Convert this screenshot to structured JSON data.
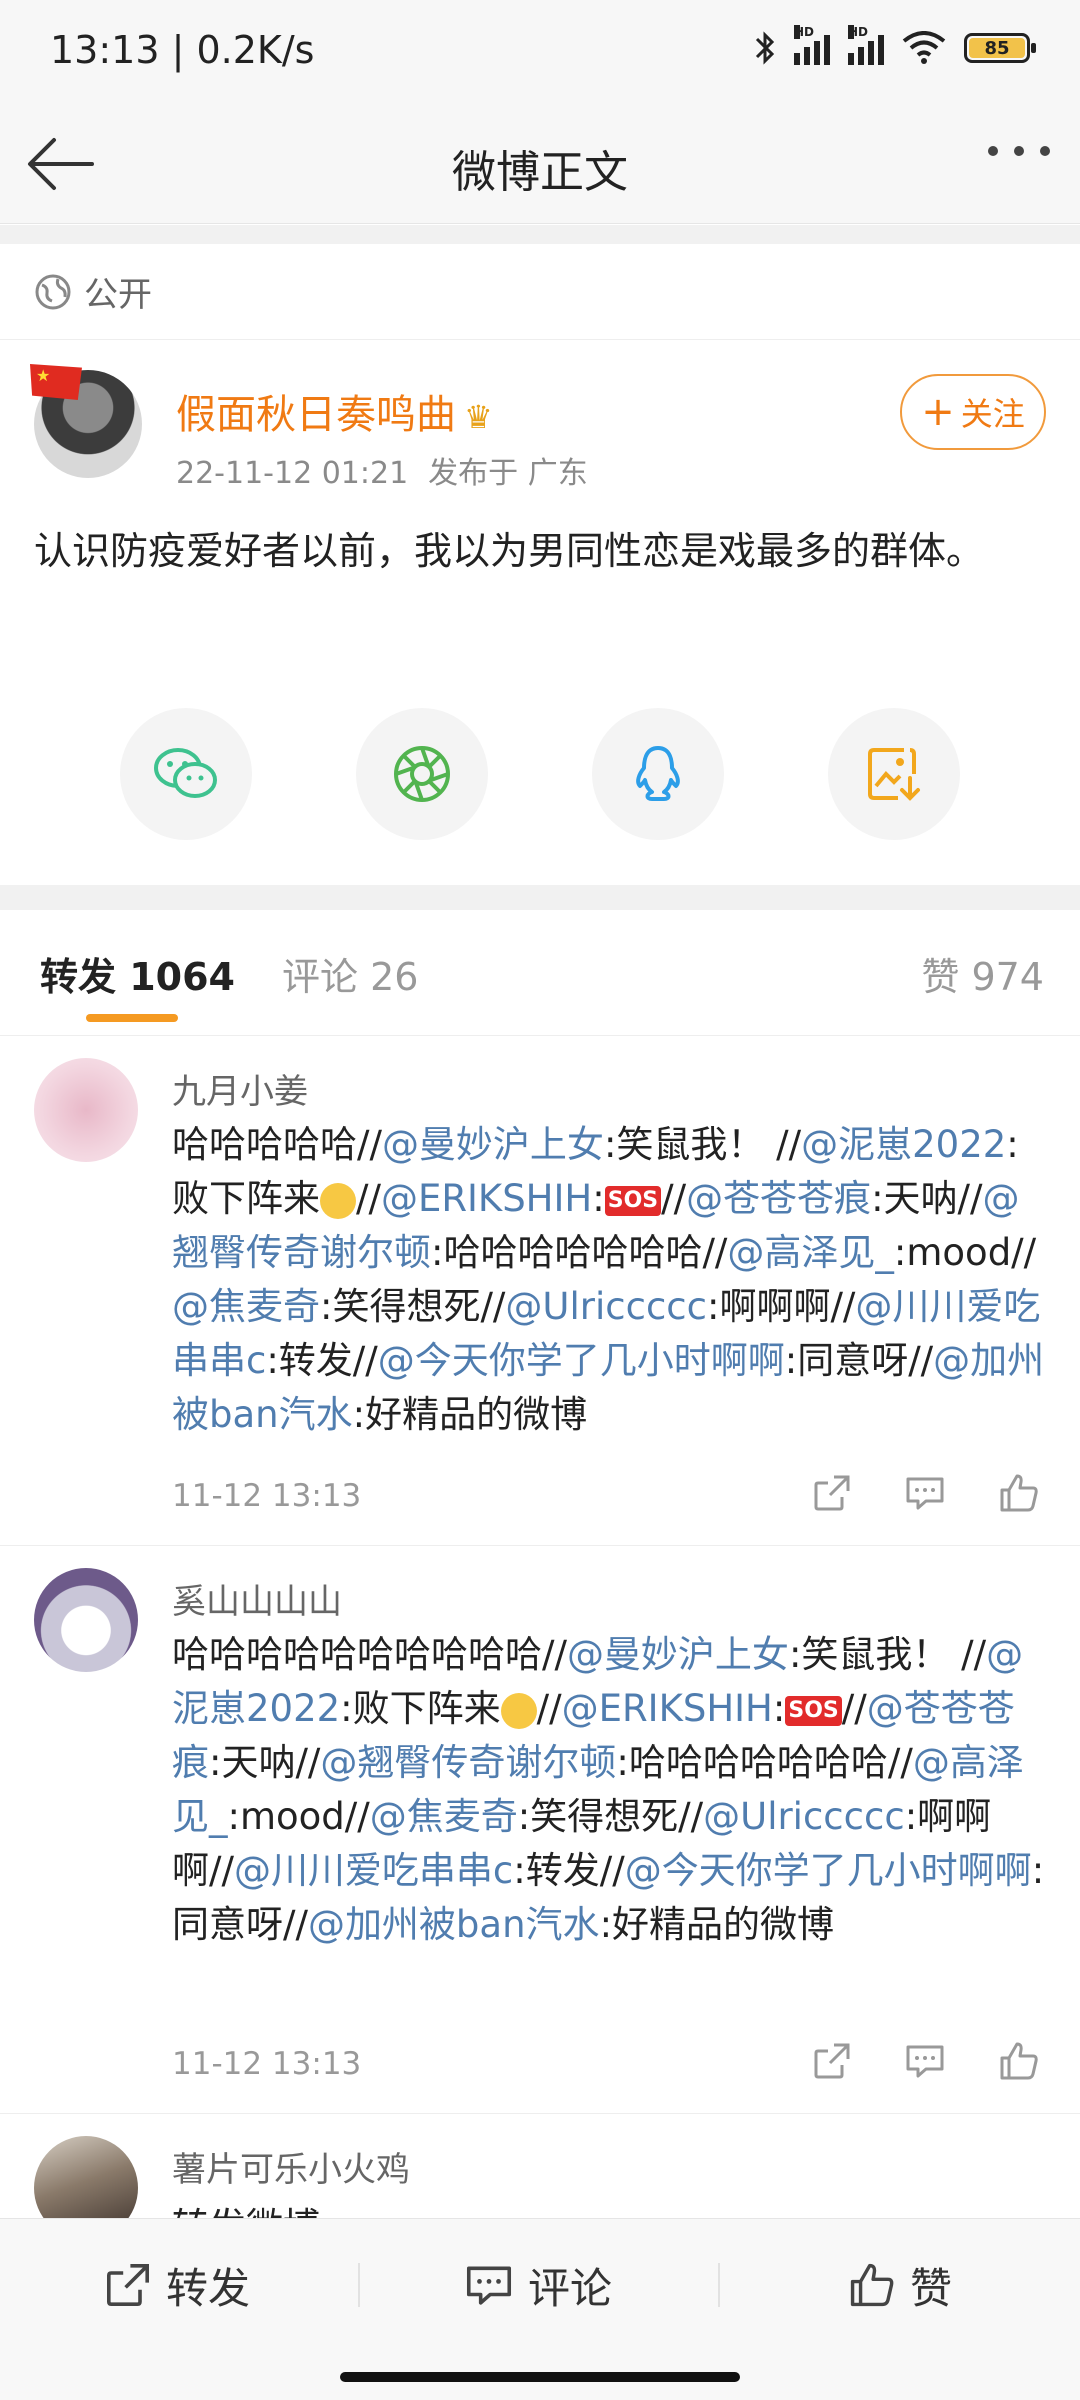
{
  "status_bar": {
    "time_speed": "13:13 | 0.2K/s",
    "battery": "85",
    "icons": [
      "bluetooth-icon",
      "signal-hd-icon",
      "signal-hd-icon",
      "wifi-icon",
      "battery-icon"
    ]
  },
  "nav": {
    "title": "微博正文"
  },
  "privacy": {
    "label": "公开"
  },
  "post": {
    "author": "假面秋日奏鸣曲",
    "date": "22-11-12 01:21",
    "location": "发布于 广东",
    "follow_label": "关注",
    "text": "认识防疫爱好者以前，我以为男同性恋是戏最多的群体。",
    "share_icons": [
      "wechat-icon",
      "moments-icon",
      "qq-icon",
      "save-image-icon"
    ]
  },
  "tabs": {
    "repost": "转发 1064",
    "comment": "评论 26",
    "like": "赞 974"
  },
  "reposts": [
    {
      "name": "九月小姜",
      "segments": [
        {
          "t": "哈哈哈哈哈//"
        },
        {
          "t": "@曼妙沪上女",
          "at": true
        },
        {
          "t": ":笑鼠我！ //"
        },
        {
          "t": "@泥崽2022",
          "at": true
        },
        {
          "t": ":败下阵来"
        },
        {
          "emoji": "cry"
        },
        {
          "t": "//"
        },
        {
          "t": "@ERIKSHIH",
          "at": true
        },
        {
          "t": ":"
        },
        {
          "emoji": "sos"
        },
        {
          "t": "//"
        },
        {
          "t": "@苍苍苍痕",
          "at": true
        },
        {
          "t": ":天呐//"
        },
        {
          "t": "@翘臀传奇谢尔顿",
          "at": true
        },
        {
          "t": ":哈哈哈哈哈哈哈//"
        },
        {
          "t": "@高泽见_",
          "at": true
        },
        {
          "t": ":mood//"
        },
        {
          "t": "@焦麦奇",
          "at": true
        },
        {
          "t": ":笑得想死//"
        },
        {
          "t": "@Ulriccccc",
          "at": true
        },
        {
          "t": ":啊啊啊//"
        },
        {
          "t": "@川川爱吃串串c",
          "at": true
        },
        {
          "t": ":转发//"
        },
        {
          "t": "@今天你学了几小时啊啊",
          "at": true
        },
        {
          "t": ":同意呀//"
        },
        {
          "t": "@加州被ban汽水",
          "at": true
        },
        {
          "t": ":好精品的微博"
        }
      ],
      "time": "11-12 13:13"
    },
    {
      "name": "奚山山山山",
      "segments": [
        {
          "t": "哈哈哈哈哈哈哈哈哈哈//"
        },
        {
          "t": "@曼妙沪上女",
          "at": true
        },
        {
          "t": ":笑鼠我！ //"
        },
        {
          "t": "@泥崽2022",
          "at": true
        },
        {
          "t": ":败下阵来"
        },
        {
          "emoji": "cry"
        },
        {
          "t": "//"
        },
        {
          "t": "@ERIKSHIH",
          "at": true
        },
        {
          "t": ":"
        },
        {
          "emoji": "sos"
        },
        {
          "t": "//"
        },
        {
          "t": "@苍苍苍痕",
          "at": true
        },
        {
          "t": ":天呐//"
        },
        {
          "t": "@翘臀传奇谢尔顿",
          "at": true
        },
        {
          "t": ":哈哈哈哈哈哈哈//"
        },
        {
          "t": "@高泽见_",
          "at": true
        },
        {
          "t": ":mood//"
        },
        {
          "t": "@焦麦奇",
          "at": true
        },
        {
          "t": ":笑得想死//"
        },
        {
          "t": "@Ulriccccc",
          "at": true
        },
        {
          "t": ":啊啊啊//"
        },
        {
          "t": "@川川爱吃串串c",
          "at": true
        },
        {
          "t": ":转发//"
        },
        {
          "t": "@今天你学了几小时啊啊",
          "at": true
        },
        {
          "t": ":同意呀//"
        },
        {
          "t": "@加州被ban汽水",
          "at": true
        },
        {
          "t": ":好精品的微博"
        }
      ],
      "time": "11-12 13:13"
    },
    {
      "name": "薯片可乐小火鸡",
      "text": "转发微博"
    }
  ],
  "bottom_bar": {
    "repost": "转发",
    "comment": "评论",
    "like": "赞"
  },
  "colors": {
    "orange_accent": "#f07a13",
    "link_blue": "#507daf",
    "tab_underline": "#f59a22"
  }
}
